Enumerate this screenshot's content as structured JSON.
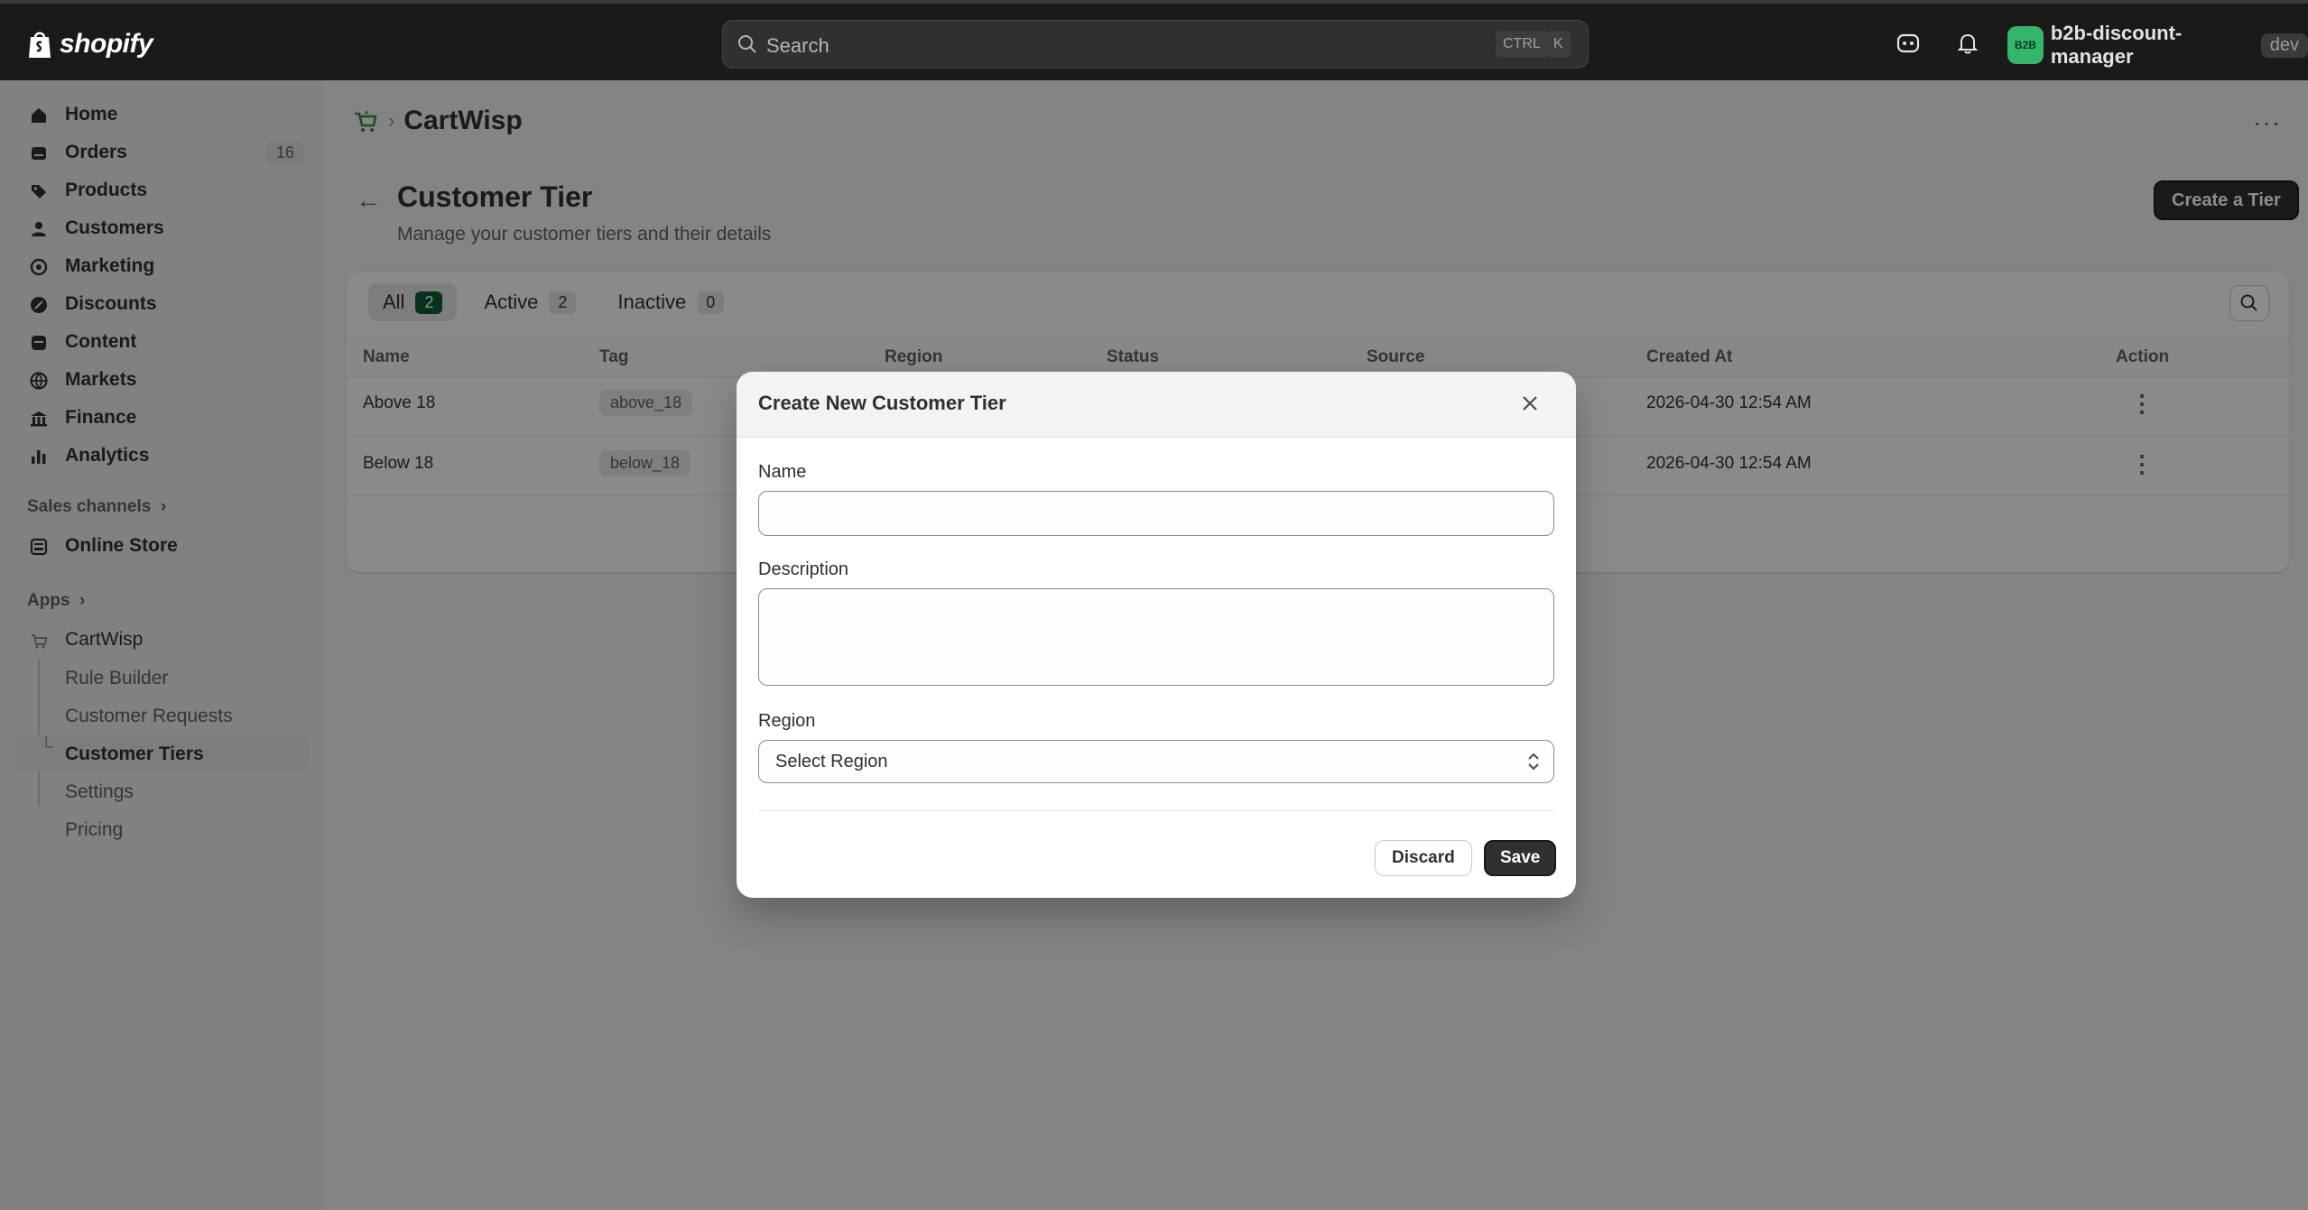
{
  "topbar": {
    "brand": "shopify",
    "search_placeholder": "Search",
    "shortcut_ctrl": "CTRL",
    "shortcut_k": "K",
    "avatar_initials": "B2B",
    "store_name": "b2b-discount-manager",
    "store_badge": "dev"
  },
  "sidebar": {
    "items": [
      {
        "label": "Home",
        "icon": "home-icon"
      },
      {
        "label": "Orders",
        "icon": "orders-icon",
        "badge": "16"
      },
      {
        "label": "Products",
        "icon": "tag-icon"
      },
      {
        "label": "Customers",
        "icon": "person-icon"
      },
      {
        "label": "Marketing",
        "icon": "target-icon"
      },
      {
        "label": "Discounts",
        "icon": "discount-icon"
      },
      {
        "label": "Content",
        "icon": "content-icon"
      },
      {
        "label": "Markets",
        "icon": "globe-icon"
      },
      {
        "label": "Finance",
        "icon": "bank-icon"
      },
      {
        "label": "Analytics",
        "icon": "bar-chart-icon"
      }
    ],
    "sales_channels_heading": "Sales channels",
    "online_store": "Online Store",
    "apps_heading": "Apps",
    "app_name": "CartWisp",
    "app_subitems": [
      "Rule Builder",
      "Customer Requests",
      "Customer Tiers",
      "Settings",
      "Pricing"
    ],
    "active_subitem": "Customer Tiers"
  },
  "header": {
    "app_title": "CartWisp",
    "page_title": "Customer Tier",
    "page_subtitle": "Manage your customer tiers and their details",
    "primary_action": "Create a Tier"
  },
  "tabs": [
    {
      "label": "All",
      "count": "2"
    },
    {
      "label": "Active",
      "count": "2"
    },
    {
      "label": "Inactive",
      "count": "0"
    }
  ],
  "table": {
    "columns": [
      "Name",
      "Tag",
      "Region",
      "Status",
      "Source",
      "Created At",
      "Action"
    ],
    "rows": [
      {
        "name": "Above 18",
        "tag": "above_18",
        "created_at": "2026-04-30 12:54 AM"
      },
      {
        "name": "Below 18",
        "tag": "below_18",
        "created_at": "2026-04-30 12:54 AM"
      }
    ]
  },
  "modal": {
    "title": "Create New Customer Tier",
    "name_label": "Name",
    "name_value": "",
    "description_label": "Description",
    "description_value": "",
    "region_label": "Region",
    "region_value": "Select Region",
    "discard_label": "Discard",
    "save_label": "Save"
  },
  "colors": {
    "topbar_bg": "#1a1a1a",
    "accent_green": "#0d5c3b",
    "primary_button": "#303030",
    "avatar_green": "#35b66a"
  }
}
